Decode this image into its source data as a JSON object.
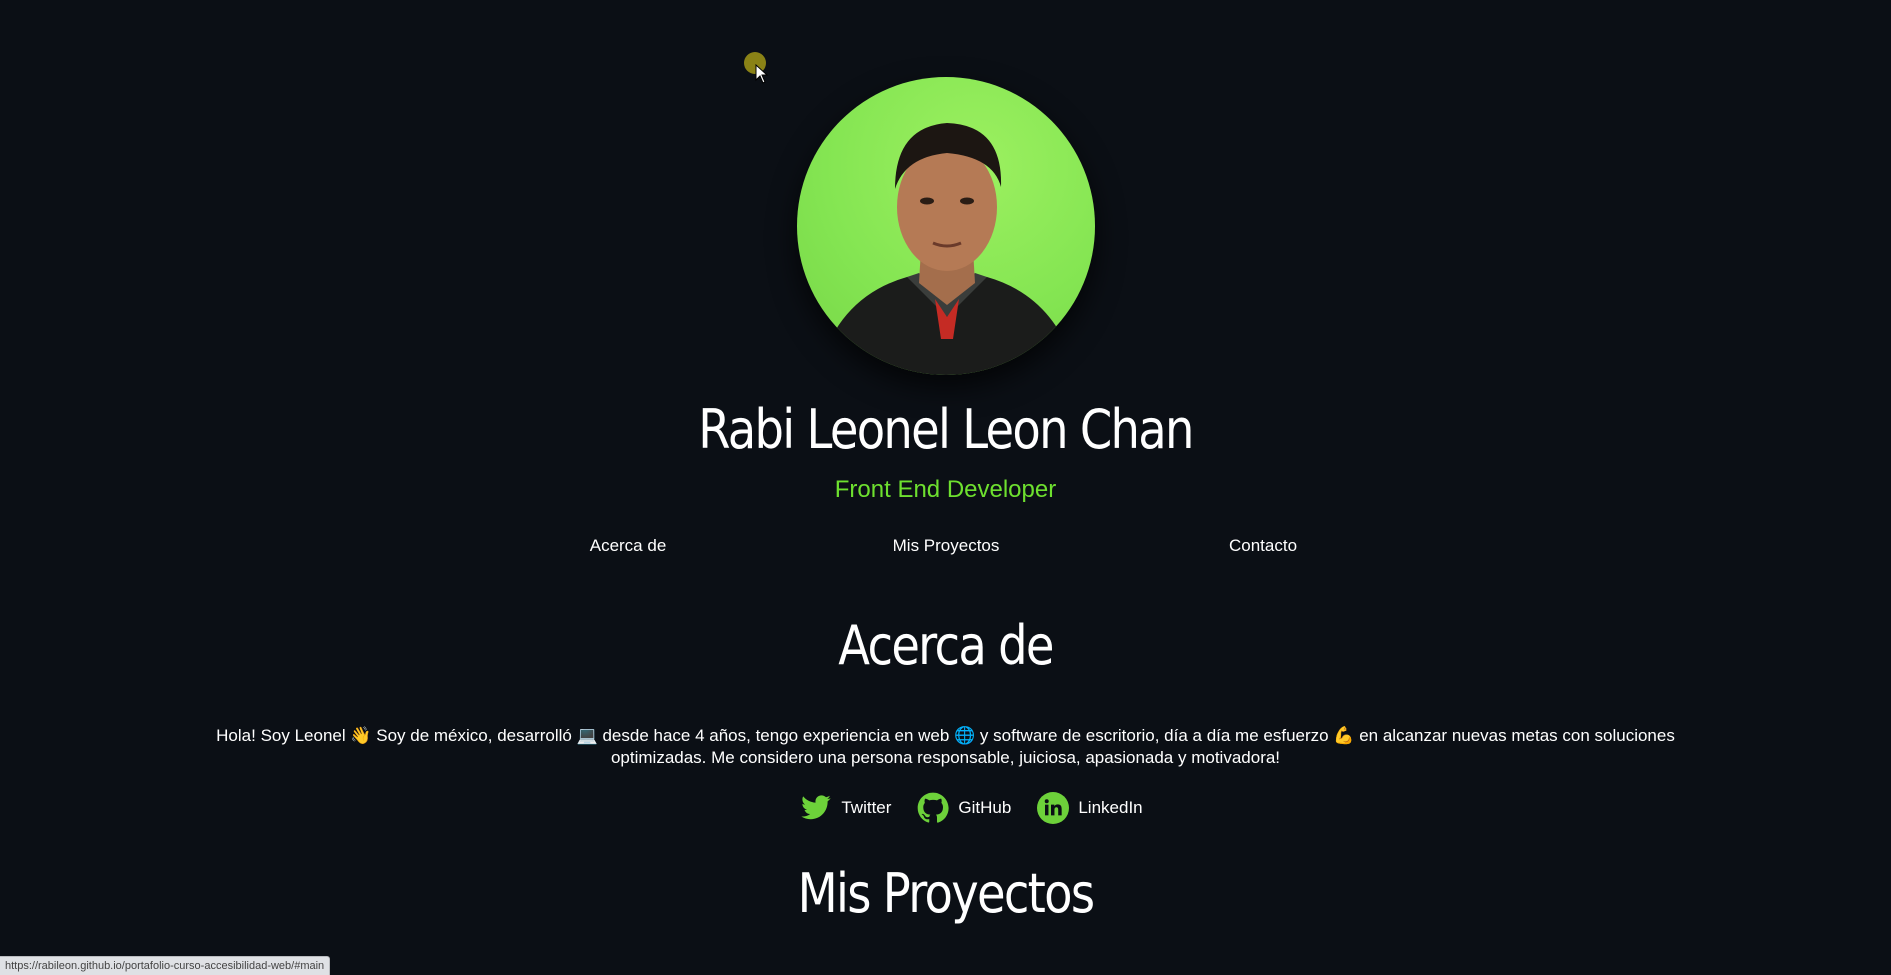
{
  "profile": {
    "name": "Rabi Leonel Leon Chan",
    "role": "Front End Developer"
  },
  "nav": {
    "items": [
      {
        "label": "Acerca de"
      },
      {
        "label": "Mis Proyectos"
      },
      {
        "label": "Contacto"
      }
    ]
  },
  "about": {
    "title": "Acerca de",
    "text": "Hola! Soy Leonel 👋 Soy de méxico, desarrolló 💻 desde hace 4 años, tengo experiencia en web 🌐 y software de escritorio, día a día me esfuerzo 💪 en alcanzar nuevas metas con soluciones optimizadas. Me considero una persona responsable, juiciosa, apasionada y motivadora!"
  },
  "social": {
    "items": [
      {
        "label": "Twitter",
        "icon": "twitter-icon"
      },
      {
        "label": "GitHub",
        "icon": "github-icon"
      },
      {
        "label": "LinkedIn",
        "icon": "linkedin-icon"
      }
    ]
  },
  "projects": {
    "title": "Mis Proyectos"
  },
  "status_bar": {
    "url": "https://rabileon.github.io/portafolio-curso-accesibilidad-web/#main"
  },
  "colors": {
    "background": "#0b0f15",
    "accent": "#6ee02f",
    "icon_green": "#6dd13a"
  }
}
